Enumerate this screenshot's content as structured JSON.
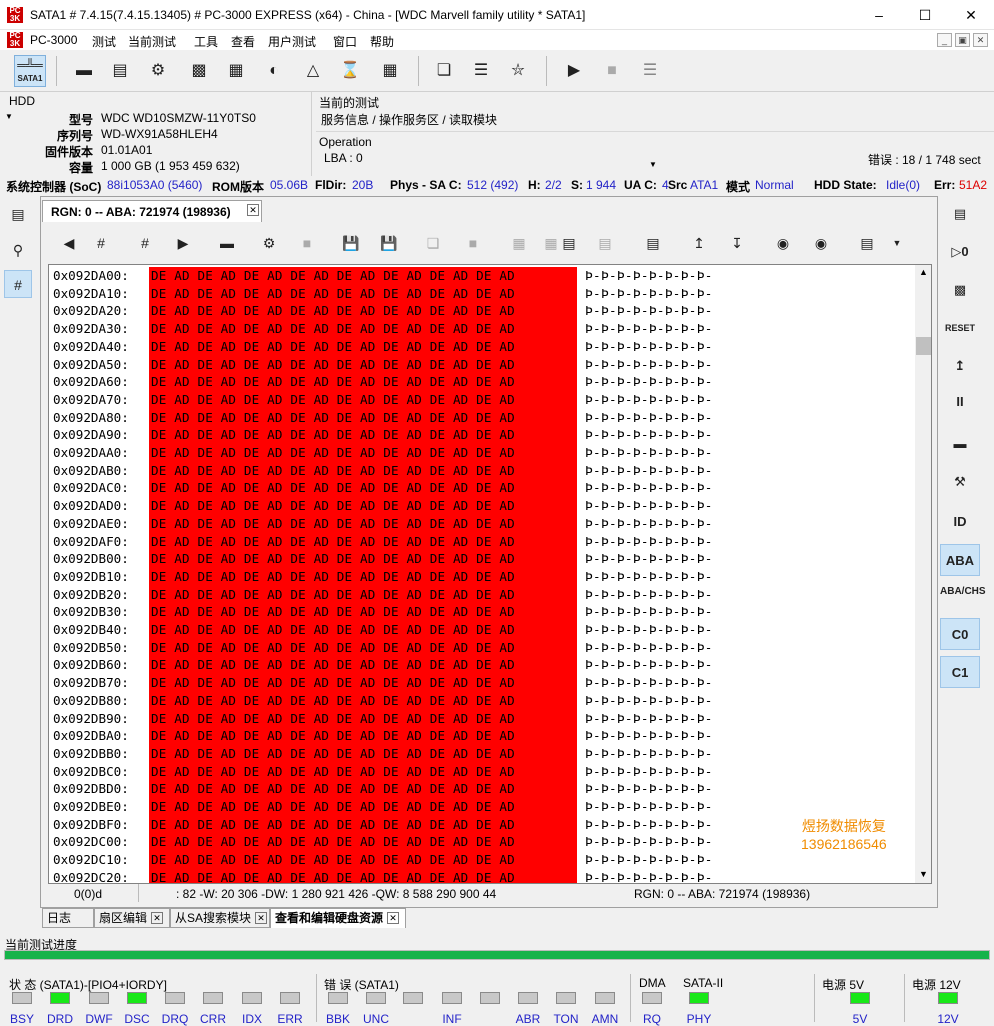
{
  "window": {
    "title": "SATA1 # 7.4.15(7.4.15.13405) # PC-3000 EXPRESS (x64) - China - [WDC Marvell family utility * SATA1]",
    "logo": "PC"
  },
  "menu": [
    "PC-3000",
    "测试",
    "当前测试",
    "工具",
    "查看",
    "用户测试",
    "窗口",
    "帮助"
  ],
  "toolbar": {
    "sata_label": "SATA1"
  },
  "hdd": {
    "section": "HDD",
    "model_label": "型号",
    "model": "WDC WD10SMZW-11Y0TS0",
    "serial_label": "序列号",
    "serial": "WD-WX91A58HLEH4",
    "firmware_label": "固件版本",
    "firmware": "01.01A01",
    "capacity_label": "容量",
    "capacity": "1 000 GB (1 953 459 632)"
  },
  "current_test": {
    "label": "当前的测试",
    "path": "服务信息 / 操作服务区 / 读取模块",
    "operation_label": "Operation",
    "lba": "LBA : 0",
    "errors": "错误 : 18 / 1 748 sect"
  },
  "status": {
    "soc_label": "系统控制器 (SoC)",
    "soc": "88i1053A0 (5460)",
    "rom_label": "ROM版本",
    "rom": "05.06B",
    "fldir_label": "FlDir:",
    "fldir": "20B",
    "phys_label": "Phys - SA C:",
    "phys": "512 (492)",
    "h_label": "H:",
    "h": "2/2",
    "s_label": "S:",
    "s": "1 944",
    "uac_label": "UA C:",
    "uac": "4",
    "src_label": "Src",
    "src": "ATA1",
    "mode_label": "模式",
    "mode": "Normal",
    "state_label": "HDD State:",
    "state": "Idle(0)",
    "err_label": "Err:",
    "err": "51A2"
  },
  "editor": {
    "tab_title": "RGN: 0 -- ABA: 721974 (198936)",
    "hex_byte": "DE AD DE AD DE AD DE AD DE AD DE AD DE AD DE AD",
    "ascii": "Þ-Þ-Þ-Þ-Þ-Þ-Þ-Þ-",
    "addresses": [
      "0x092DA00:",
      "0x092DA10:",
      "0x092DA20:",
      "0x092DA30:",
      "0x092DA40:",
      "0x092DA50:",
      "0x092DA60:",
      "0x092DA70:",
      "0x092DA80:",
      "0x092DA90:",
      "0x092DAA0:",
      "0x092DAB0:",
      "0x092DAC0:",
      "0x092DAD0:",
      "0x092DAE0:",
      "0x092DAF0:",
      "0x092DB00:",
      "0x092DB10:",
      "0x092DB20:",
      "0x092DB30:",
      "0x092DB40:",
      "0x092DB50:",
      "0x092DB60:",
      "0x092DB70:",
      "0x092DB80:",
      "0x092DB90:",
      "0x092DBA0:",
      "0x092DBB0:",
      "0x092DBC0:",
      "0x092DBD0:",
      "0x092DBE0:",
      "0x092DBF0:",
      "0x092DC00:",
      "0x092DC10:",
      "0x092DC20:"
    ],
    "status_offset": "0(0)d",
    "status_values": ": 82 -W: 20 306 -DW: 1 280 921 426 -QW: 8 588 290 900 44",
    "status_rgn": "RGN: 0 -- ABA: 721974 (198936)",
    "watermark_line1": "煜扬数据恢复",
    "watermark_line2": "13962186546"
  },
  "bottom_tabs": [
    "日志",
    "扇区编辑",
    "从SA搜索模块",
    "查看和编辑硬盘资源"
  ],
  "progress": {
    "label": "当前测试进度",
    "value": 1.0
  },
  "indicators": {
    "status_group": "状 态 (SATA1)-[PIO4+IORDY]",
    "error_group": "错 误 (SATA1)",
    "dma_group": "DMA",
    "sata_group": "SATA-II",
    "p5_group": "电源 5V",
    "p12_group": "电源 12V",
    "status_leds": [
      {
        "label": "BSY",
        "on": false
      },
      {
        "label": "DRD",
        "on": true
      },
      {
        "label": "DWF",
        "on": false
      },
      {
        "label": "DSC",
        "on": true
      },
      {
        "label": "DRQ",
        "on": false
      },
      {
        "label": "CRR",
        "on": false
      },
      {
        "label": "IDX",
        "on": false
      },
      {
        "label": "ERR",
        "on": false
      }
    ],
    "error_leds": [
      {
        "label": "BBK",
        "on": false
      },
      {
        "label": "UNC",
        "on": false
      },
      {
        "label": "",
        "on": false
      },
      {
        "label": "INF",
        "on": false
      },
      {
        "label": "",
        "on": false
      },
      {
        "label": "ABR",
        "on": false
      },
      {
        "label": "TON",
        "on": false
      },
      {
        "label": "AMN",
        "on": false
      }
    ],
    "dma_led": {
      "label": "RQ",
      "on": false
    },
    "sata_led": {
      "label": "PHY",
      "on": true
    },
    "p5_led": {
      "label": "5V",
      "on": true
    },
    "p12_led": {
      "label": "12V",
      "on": true
    }
  },
  "right_dock": [
    "ID",
    "ABA",
    "ABA/CHS",
    "C0",
    "C1"
  ]
}
